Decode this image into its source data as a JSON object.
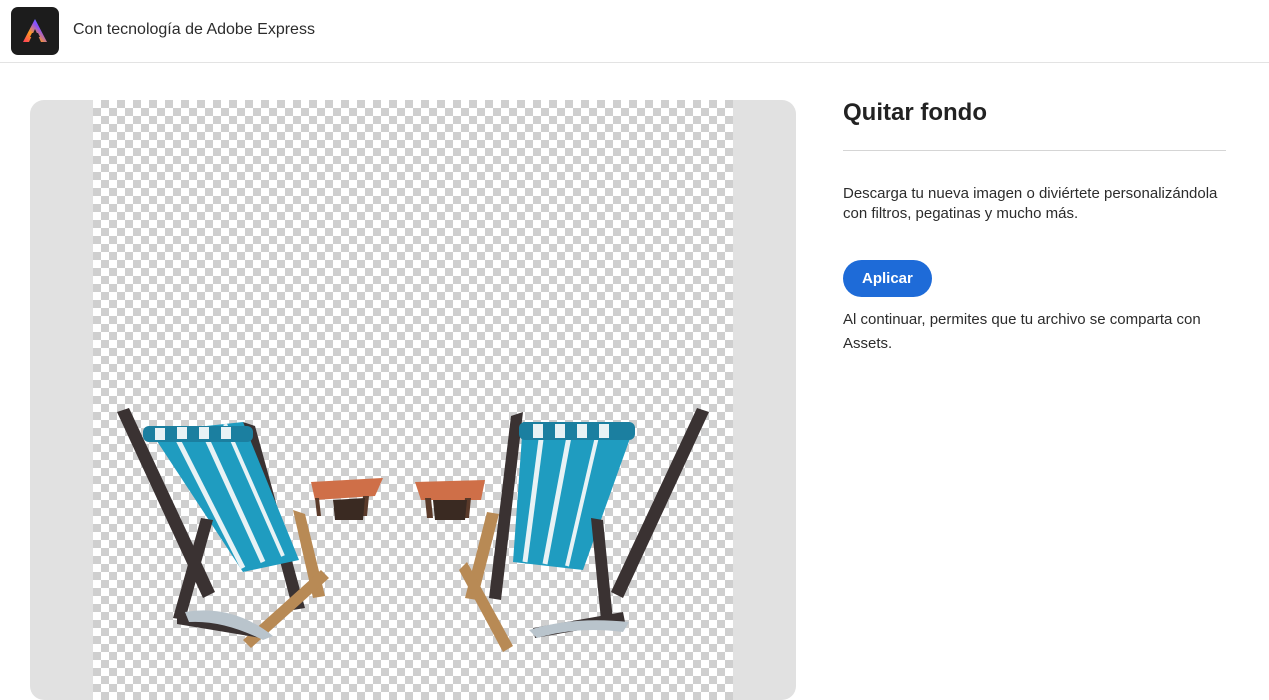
{
  "header": {
    "brand_text": "Con tecnología de Adobe Express",
    "logo_icon": "adobe-express-logo-icon"
  },
  "preview": {
    "image_subject": "two-beach-chairs-with-side-tables",
    "background": "transparent-checkerboard"
  },
  "panel": {
    "title": "Quitar fondo",
    "description": "Descarga tu nueva imagen o diviértete personalizándola con filtros, pegatinas y mucho más.",
    "apply_label": "Aplicar",
    "note": "Al continuar, permites que tu archivo se comparta con Assets."
  },
  "colors": {
    "accent": "#1e6bd8",
    "logo_bg": "#1c1c1c",
    "frame_bg": "#e1e1e1",
    "chair_fabric": "#1f9cc0",
    "chair_wood": "#b88a55"
  }
}
